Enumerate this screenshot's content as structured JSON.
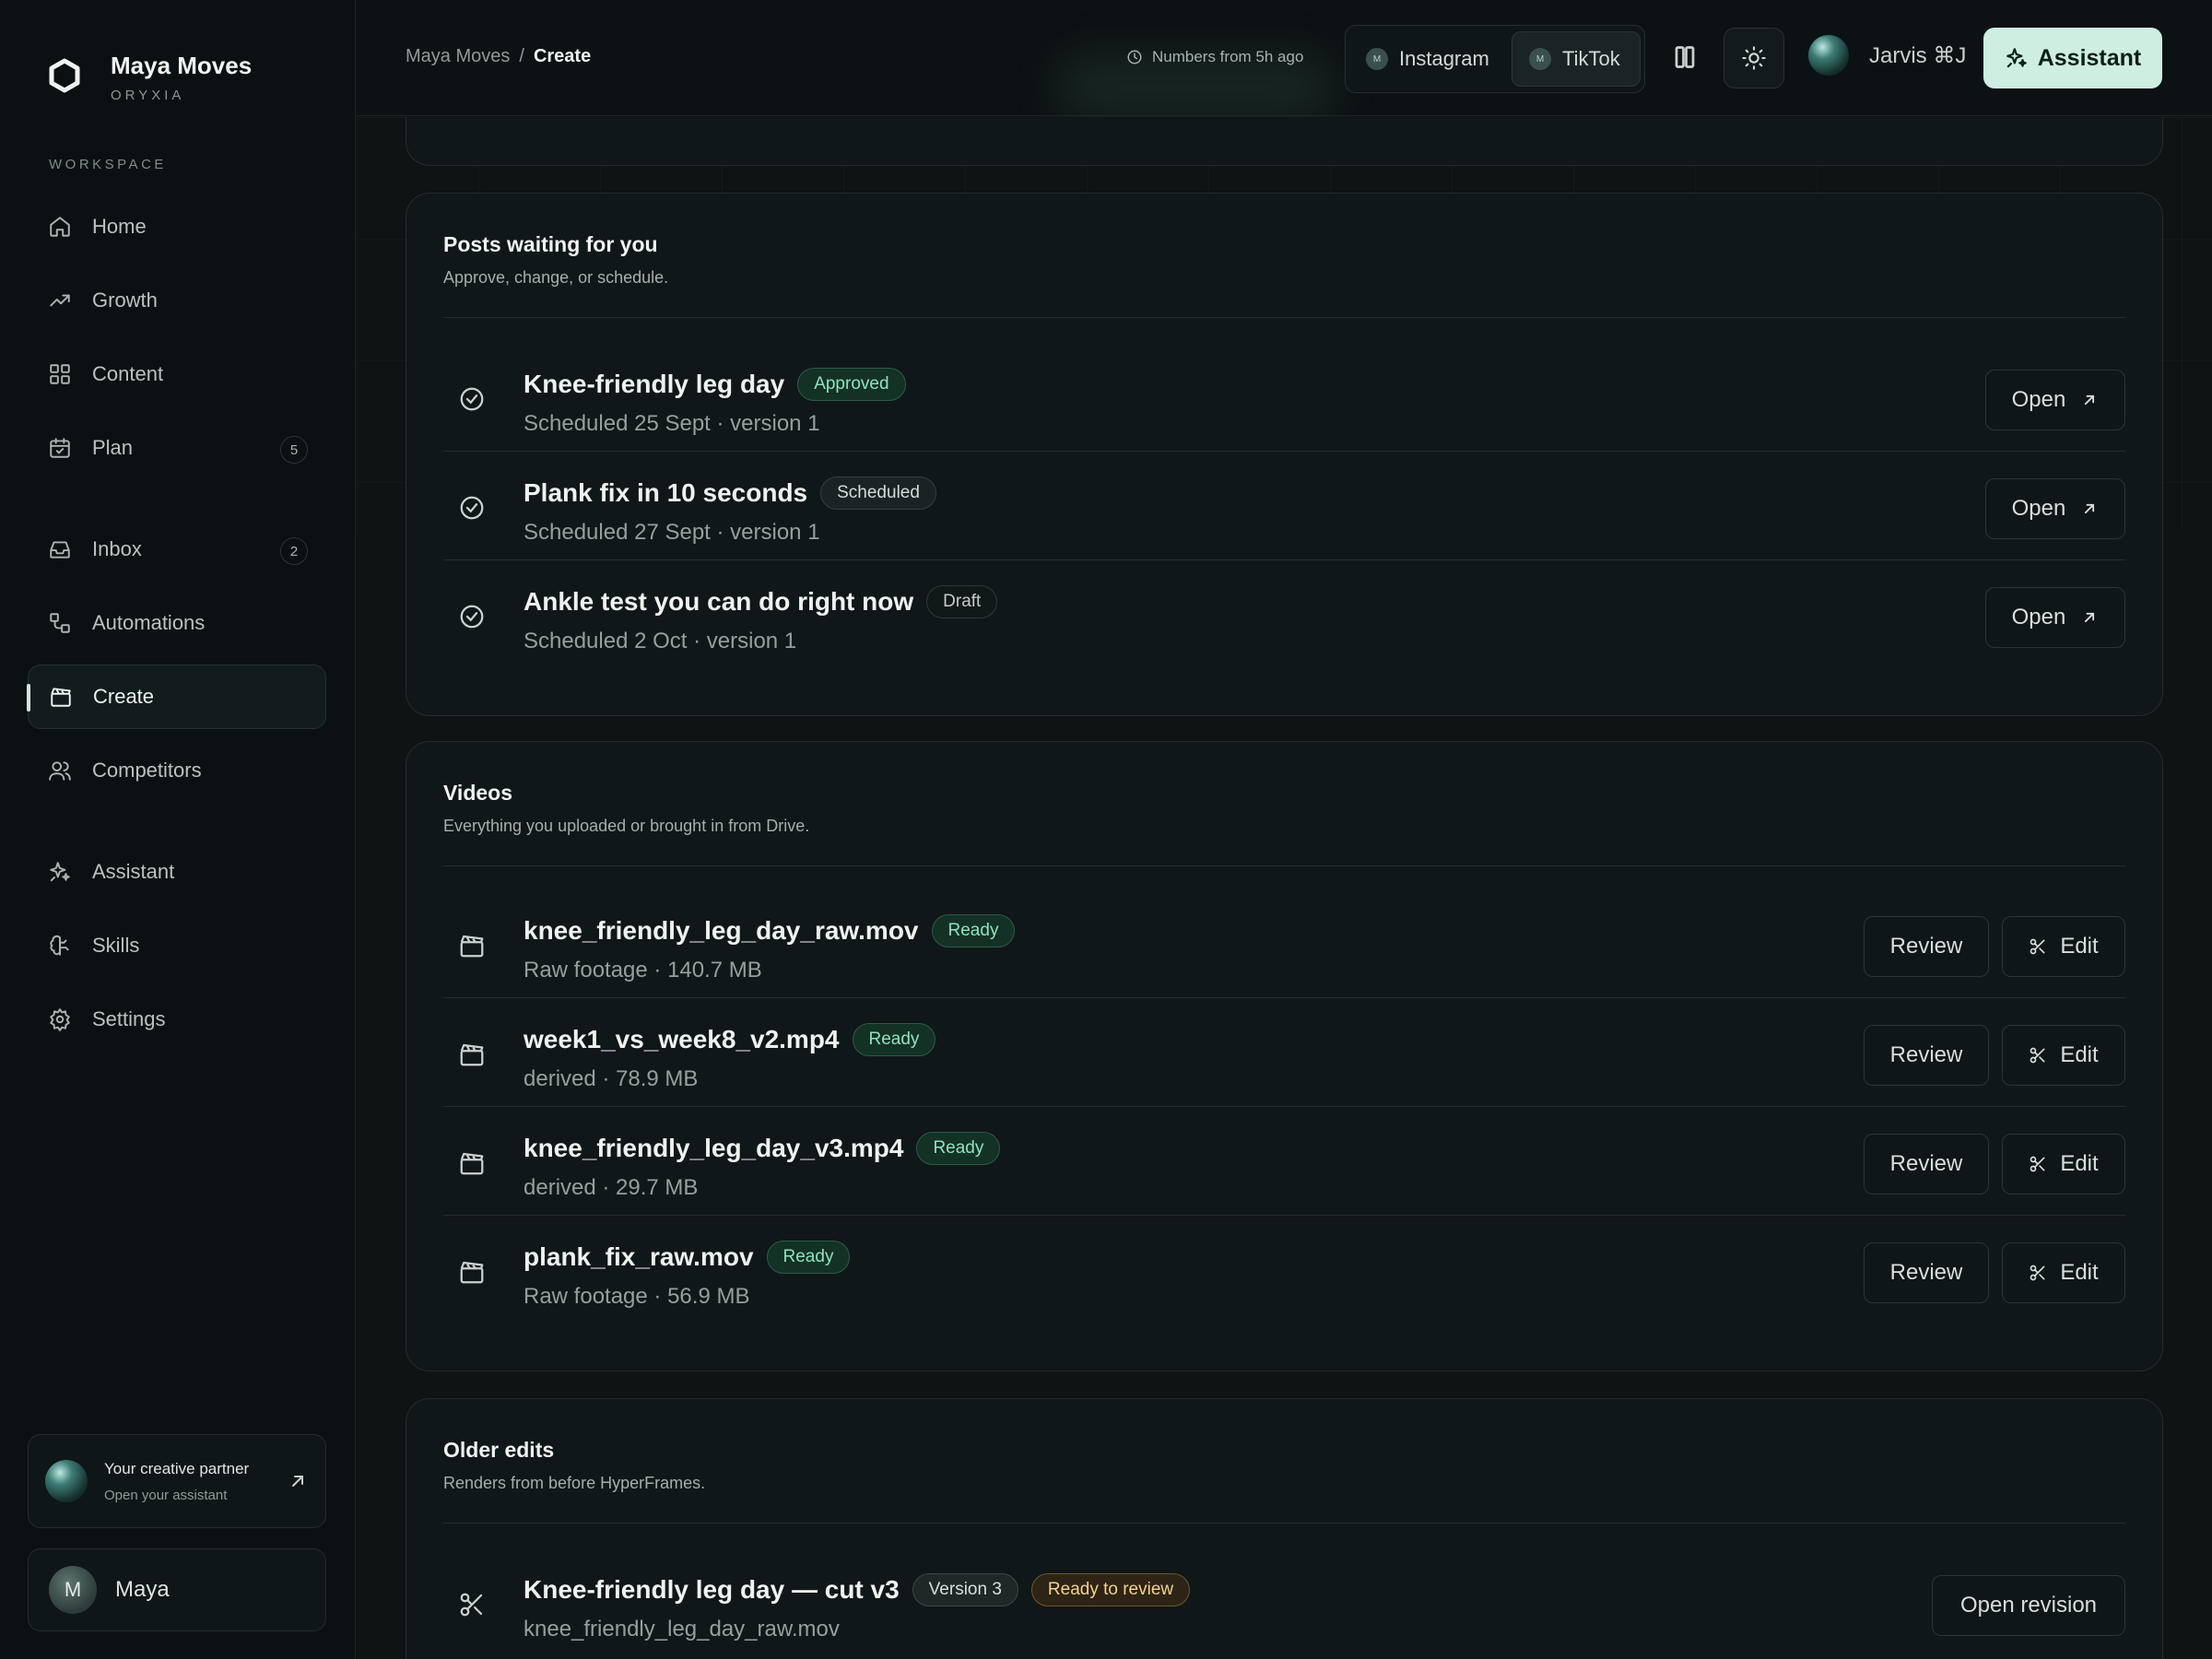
{
  "brand": {
    "name": "Maya Moves",
    "sub": "ORYXIA"
  },
  "sidebar": {
    "section_label": "WORKSPACE",
    "items": [
      {
        "label": "Home",
        "icon": "home-icon"
      },
      {
        "label": "Growth",
        "icon": "trending-up-icon"
      },
      {
        "label": "Content",
        "icon": "grid-icon"
      },
      {
        "label": "Plan",
        "icon": "calendar-icon",
        "badge": "5"
      },
      {
        "label": "Inbox",
        "icon": "inbox-icon",
        "badge": "2"
      },
      {
        "label": "Automations",
        "icon": "workflow-icon"
      },
      {
        "label": "Create",
        "icon": "clapperboard-icon",
        "active": true
      },
      {
        "label": "Competitors",
        "icon": "users-icon"
      },
      {
        "label": "Assistant",
        "icon": "sparkles-icon"
      },
      {
        "label": "Skills",
        "icon": "brain-icon"
      },
      {
        "label": "Settings",
        "icon": "gear-icon"
      }
    ],
    "partner": {
      "title": "Your creative partner",
      "subtitle": "Open your assistant"
    },
    "user": {
      "initial": "M",
      "name": "Maya"
    }
  },
  "topbar": {
    "breadcrumb": {
      "parent": "Maya Moves",
      "separator": "/",
      "current": "Create"
    },
    "freshness": "Numbers from 5h ago",
    "platforms": [
      {
        "label": "Instagram",
        "initial": "M"
      },
      {
        "label": "TikTok",
        "initial": "M",
        "selected": true
      }
    ],
    "jarvis_label": "Jarvis ⌘J",
    "assistant_label": "Assistant"
  },
  "posts": {
    "title": "Posts waiting for you",
    "subtitle": "Approve, change, or schedule.",
    "items": [
      {
        "title": "Knee-friendly leg day",
        "status": "Approved",
        "meta": "Scheduled 25 Sept · version 1",
        "action": "Open"
      },
      {
        "title": "Plank fix in 10 seconds",
        "status": "Scheduled",
        "meta": "Scheduled 27 Sept · version 1",
        "action": "Open"
      },
      {
        "title": "Ankle test you can do right now",
        "status": "Draft",
        "meta": "Scheduled 2 Oct · version 1",
        "action": "Open"
      }
    ]
  },
  "videos": {
    "title": "Videos",
    "subtitle": "Everything you uploaded or brought in from Drive.",
    "review_label": "Review",
    "edit_label": "Edit",
    "items": [
      {
        "title": "knee_friendly_leg_day_raw.mov",
        "status": "Ready",
        "meta": "Raw footage · 140.7 MB"
      },
      {
        "title": "week1_vs_week8_v2.mp4",
        "status": "Ready",
        "meta": "derived · 78.9 MB"
      },
      {
        "title": "knee_friendly_leg_day_v3.mp4",
        "status": "Ready",
        "meta": "derived · 29.7 MB"
      },
      {
        "title": "plank_fix_raw.mov",
        "status": "Ready",
        "meta": "Raw footage · 56.9 MB"
      }
    ]
  },
  "older": {
    "title": "Older edits",
    "subtitle": "Renders from before HyperFrames.",
    "items": [
      {
        "title": "Knee-friendly leg day — cut v3",
        "version": "Version 3",
        "status": "Ready to review",
        "meta": "knee_friendly_leg_day_raw.mov",
        "action": "Open revision"
      }
    ]
  },
  "colors": {
    "accent": "#cfeee2",
    "background": "#0e1314",
    "ready_badge": "#8fe2bd",
    "review_badge": "#f3d28f"
  }
}
